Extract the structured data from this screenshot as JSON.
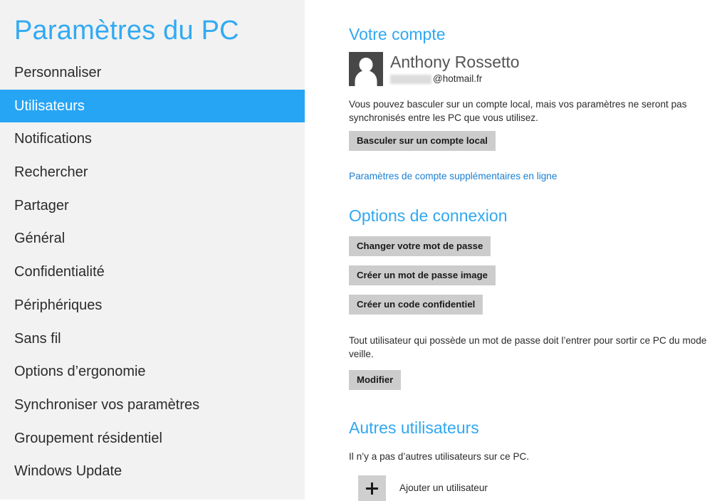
{
  "sidebar": {
    "title": "Paramètres du PC",
    "items": [
      {
        "label": "Personnaliser",
        "selected": false
      },
      {
        "label": "Utilisateurs",
        "selected": true
      },
      {
        "label": "Notifications",
        "selected": false
      },
      {
        "label": "Rechercher",
        "selected": false
      },
      {
        "label": "Partager",
        "selected": false
      },
      {
        "label": "Général",
        "selected": false
      },
      {
        "label": "Confidentialité",
        "selected": false
      },
      {
        "label": "Périphériques",
        "selected": false
      },
      {
        "label": "Sans fil",
        "selected": false
      },
      {
        "label": "Options d’ergonomie",
        "selected": false
      },
      {
        "label": "Synchroniser vos paramètres",
        "selected": false
      },
      {
        "label": "Groupement résidentiel",
        "selected": false
      },
      {
        "label": "Windows Update",
        "selected": false
      }
    ]
  },
  "content": {
    "account_section": {
      "heading": "Votre compte",
      "avatar_icon": "user-silhouette-icon",
      "user_name": "Anthony Rossetto",
      "email_redacted": true,
      "email_domain": "@hotmail.fr",
      "description": "Vous pouvez basculer sur un compte local, mais vos paramètres ne seront pas synchronisés entre les PC que vous utilisez.",
      "switch_button_label": "Basculer sur un compte local",
      "online_settings_link": "Paramètres de compte supplémentaires en ligne"
    },
    "signin_section": {
      "heading": "Options de connexion",
      "buttons": [
        {
          "label": "Changer votre mot de passe"
        },
        {
          "label": "Créer un mot de passe image"
        },
        {
          "label": "Créer un code confidentiel"
        }
      ],
      "sleep_text": "Tout utilisateur qui possède un mot de passe doit l’entrer pour sortir ce PC du mode veille.",
      "sleep_button_label": "Modifier"
    },
    "others_section": {
      "heading": "Autres utilisateurs",
      "empty_text": "Il n’y a pas d’autres utilisateurs sur ce PC.",
      "add_user_icon": "plus-icon",
      "add_user_label": "Ajouter un utilisateur"
    }
  },
  "colors": {
    "accent_blue": "#30a8f0",
    "selection_blue": "#27a5f5",
    "link_blue": "#1a7fd4",
    "sidebar_bg": "#f2f2f2",
    "button_bg": "#cccccc",
    "avatar_bg": "#474747"
  }
}
